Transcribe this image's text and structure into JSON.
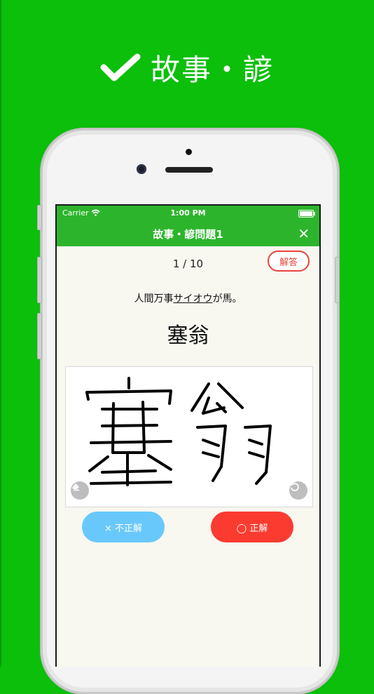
{
  "promo": {
    "title": "故事・諺",
    "check_icon": "checkmark-icon"
  },
  "status": {
    "carrier": "Carrier",
    "time": "1:00 PM"
  },
  "nav": {
    "title": "故事・諺問題1",
    "close_label": "✕"
  },
  "quiz": {
    "counter": "1 / 10",
    "answer_button": "解答",
    "question_before": "人間万事",
    "question_underlined": "サイオウ",
    "question_after": "が馬。",
    "answer": "塞翁"
  },
  "buttons": {
    "incorrect": "× 不正解",
    "correct": "◯ 正解"
  },
  "colors": {
    "background": "#0bbf0b",
    "nav": "#2cb52c",
    "incorrect": "#69c8fb",
    "correct": "#fb3b30",
    "screen": "#f8f7f0"
  }
}
